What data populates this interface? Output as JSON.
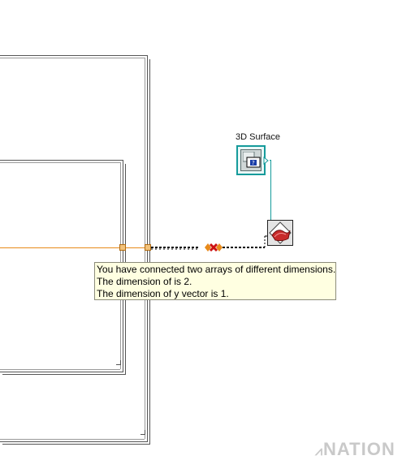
{
  "diagram": {
    "terminal_label": "3D Surface",
    "tooltip": {
      "line1": "You have connected two arrays of different dimensions.",
      "line2": "The dimension of  is 2.",
      "line3": "The dimension of y vector is 1."
    },
    "watermark": "NATION",
    "colors": {
      "wire": "#e88a1a",
      "surface_terminal": "#159b9b",
      "tooltip_bg": "#ffffe1"
    },
    "icons": [
      "3d-surface-terminal-icon",
      "3d-surface-plot-node-icon",
      "coercion-dot-icon",
      "broken-wire-icon",
      "tunnel-icon"
    ]
  }
}
